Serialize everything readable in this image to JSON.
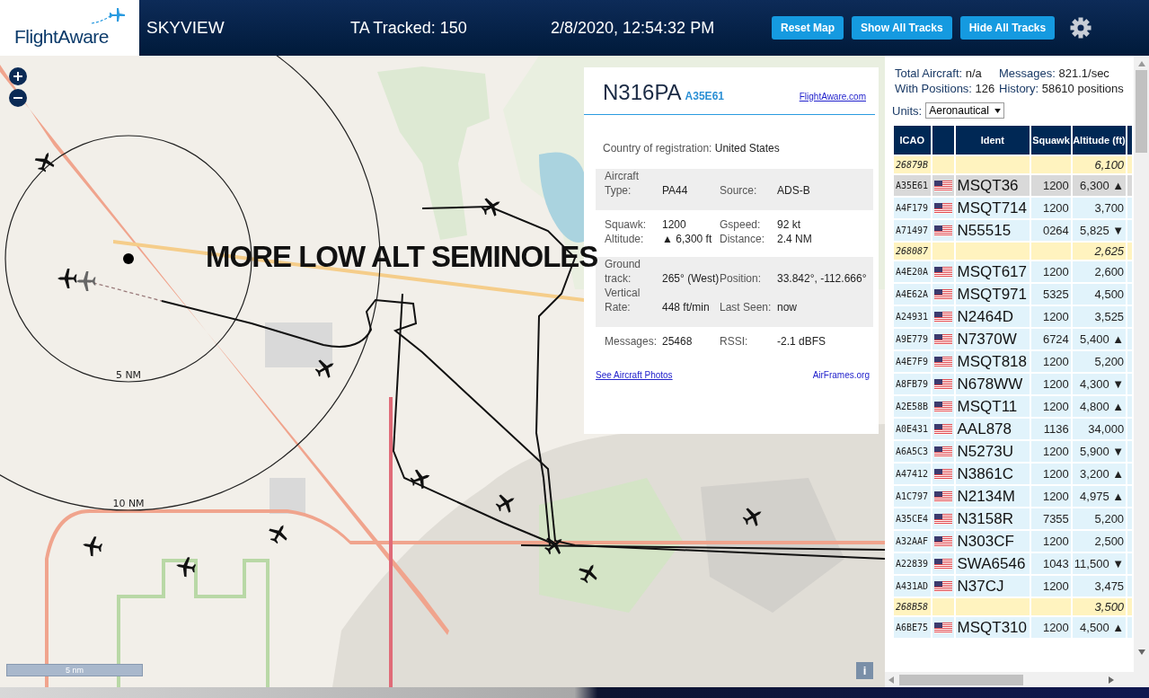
{
  "header": {
    "logo": "FlightAware",
    "title": "SKYVIEW",
    "tracked": "TA Tracked: 150",
    "datetime": "2/8/2020, 12:54:32 PM",
    "buttons": [
      "Reset Map",
      "Show All Tracks",
      "Hide All Tracks"
    ]
  },
  "map": {
    "kind": "picture",
    "annotation": "MORE LOW ALT SEMINOLES",
    "range_rings": [
      "5 NM",
      "10 NM"
    ],
    "scale": "5 nm",
    "info_button": "i"
  },
  "popup": {
    "callsign": "N316PA",
    "hex": "A35E61",
    "link": "FlightAware.com",
    "country_label": "Country of registration:",
    "country": "United States",
    "sections": [
      {
        "shaded": true,
        "fields": [
          {
            "label": "Aircraft Type:",
            "value": "PA44"
          },
          {
            "label": "Source:",
            "value": "ADS-B"
          }
        ]
      },
      {
        "shaded": false,
        "fields": [
          {
            "label": "Squawk:",
            "value": "1200"
          },
          {
            "label": "Gspeed:",
            "value": "92 kt"
          },
          {
            "label": "Altitude:",
            "value": "▲ 6,300 ft"
          },
          {
            "label": "Distance:",
            "value": "2.4 NM"
          }
        ]
      },
      {
        "shaded": true,
        "fields": [
          {
            "label": "Ground track:",
            "value": "265° (West)"
          },
          {
            "label": "Position:",
            "value": "33.842°, -112.666°"
          },
          {
            "label": "Vertical Rate:",
            "value": "448 ft/min"
          },
          {
            "label": "Last Seen:",
            "value": "now"
          }
        ]
      },
      {
        "shaded": false,
        "fields": [
          {
            "label": "Messages:",
            "value": "25468"
          },
          {
            "label": "RSSI:",
            "value": "-2.1 dBFS"
          }
        ]
      }
    ],
    "footer_links": [
      "See Aircraft Photos",
      "AirFrames.org"
    ]
  },
  "stats": [
    {
      "label": "Total Aircraft:",
      "value": "n/a"
    },
    {
      "label": "Messages:",
      "value": "821.1/sec"
    },
    {
      "label": "With Positions:",
      "value": "126"
    },
    {
      "label": "History:",
      "value": "58610 positions"
    }
  ],
  "units": {
    "label": "Units:",
    "value": "Aeronautical"
  },
  "table": {
    "columns": [
      "ICAO",
      "Ident",
      "Squawk",
      "Altitude (ft)"
    ],
    "rows": [
      {
        "kind": "no_position",
        "selected": false,
        "icao": "26879B",
        "altitude": "6,100"
      },
      {
        "kind": "aircraft",
        "selected": true,
        "icao": "A35E61",
        "ident": "MSQT36",
        "squawk": "1200",
        "altitude": "6,300",
        "trend": "▲"
      },
      {
        "kind": "aircraft",
        "selected": false,
        "icao": "A4F179",
        "ident": "MSQT714",
        "squawk": "1200",
        "altitude": "3,700"
      },
      {
        "kind": "aircraft",
        "selected": false,
        "icao": "A71497",
        "ident": "N55515",
        "squawk": "0264",
        "altitude": "5,825",
        "trend": "▼"
      },
      {
        "kind": "no_position",
        "selected": false,
        "icao": "268087",
        "altitude": "2,625"
      },
      {
        "kind": "aircraft",
        "selected": false,
        "icao": "A4E20A",
        "ident": "MSQT617",
        "squawk": "1200",
        "altitude": "2,600"
      },
      {
        "kind": "aircraft",
        "selected": false,
        "icao": "A4E62A",
        "ident": "MSQT971",
        "squawk": "5325",
        "altitude": "4,500"
      },
      {
        "kind": "aircraft",
        "selected": false,
        "icao": "A24931",
        "ident": "N2464D",
        "squawk": "1200",
        "altitude": "3,525"
      },
      {
        "kind": "aircraft",
        "selected": false,
        "icao": "A9E779",
        "ident": "N7370W",
        "squawk": "6724",
        "altitude": "5,400",
        "trend": "▲"
      },
      {
        "kind": "aircraft",
        "selected": false,
        "icao": "A4E7F9",
        "ident": "MSQT818",
        "squawk": "1200",
        "altitude": "5,200"
      },
      {
        "kind": "aircraft",
        "selected": false,
        "icao": "A8FB79",
        "ident": "N678WW",
        "squawk": "1200",
        "altitude": "4,300",
        "trend": "▼"
      },
      {
        "kind": "aircraft",
        "selected": false,
        "icao": "A2E58B",
        "ident": "MSQT11",
        "squawk": "1200",
        "altitude": "4,800",
        "trend": "▲"
      },
      {
        "kind": "aircraft",
        "selected": false,
        "icao": "A0E431",
        "ident": "AAL878",
        "squawk": "1136",
        "altitude": "34,000"
      },
      {
        "kind": "aircraft",
        "selected": false,
        "icao": "A6A5C3",
        "ident": "N5273U",
        "squawk": "1200",
        "altitude": "5,900",
        "trend": "▼"
      },
      {
        "kind": "aircraft",
        "selected": false,
        "icao": "A47412",
        "ident": "N3861C",
        "squawk": "1200",
        "altitude": "3,200",
        "trend": "▲"
      },
      {
        "kind": "aircraft",
        "selected": false,
        "icao": "A1C797",
        "ident": "N2134M",
        "squawk": "1200",
        "altitude": "4,975",
        "trend": "▲"
      },
      {
        "kind": "aircraft",
        "selected": false,
        "icao": "A35CE4",
        "ident": "N3158R",
        "squawk": "7355",
        "altitude": "5,200"
      },
      {
        "kind": "aircraft",
        "selected": false,
        "icao": "A32AAF",
        "ident": "N303CF",
        "squawk": "1200",
        "altitude": "2,500"
      },
      {
        "kind": "aircraft",
        "selected": false,
        "icao": "A22839",
        "ident": "SWA6546",
        "squawk": "1043",
        "altitude": "11,500",
        "trend": "▼"
      },
      {
        "kind": "aircraft",
        "selected": false,
        "icao": "A431AD",
        "ident": "N37CJ",
        "squawk": "1200",
        "altitude": "3,475"
      },
      {
        "kind": "no_position",
        "selected": false,
        "icao": "268B58",
        "altitude": "3,500"
      },
      {
        "kind": "aircraft",
        "selected": false,
        "icao": "A6BE75",
        "ident": "MSQT310",
        "squawk": "1200",
        "altitude": "4,500",
        "trend": "▲"
      }
    ]
  }
}
